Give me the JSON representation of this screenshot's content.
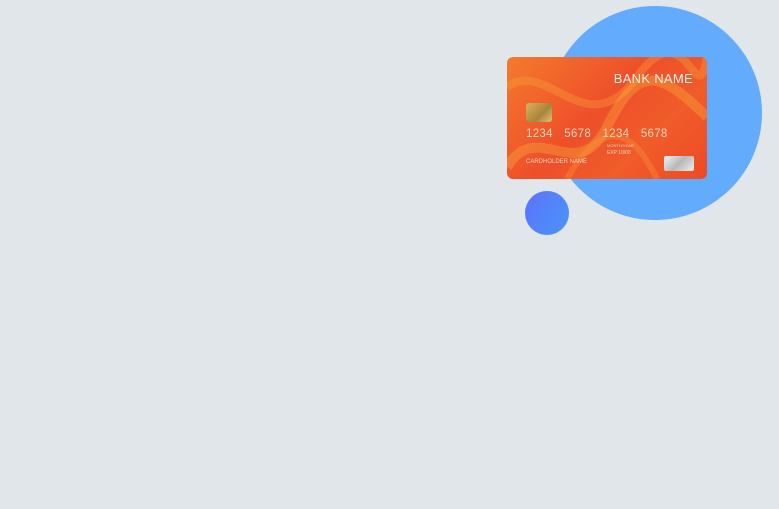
{
  "card": {
    "bank_name": "BANK NAME",
    "number": "1234 5678 1234 5678",
    "month_year_label": "MONTH/YEAR",
    "expiry": "EXP  10/08",
    "holder_name": "CARDHOLDER NAME"
  },
  "colors": {
    "background": "#e1e6eb",
    "big_circle": "#62abfd",
    "small_circle": "#5b73fb",
    "card": "#ee4f2a"
  }
}
